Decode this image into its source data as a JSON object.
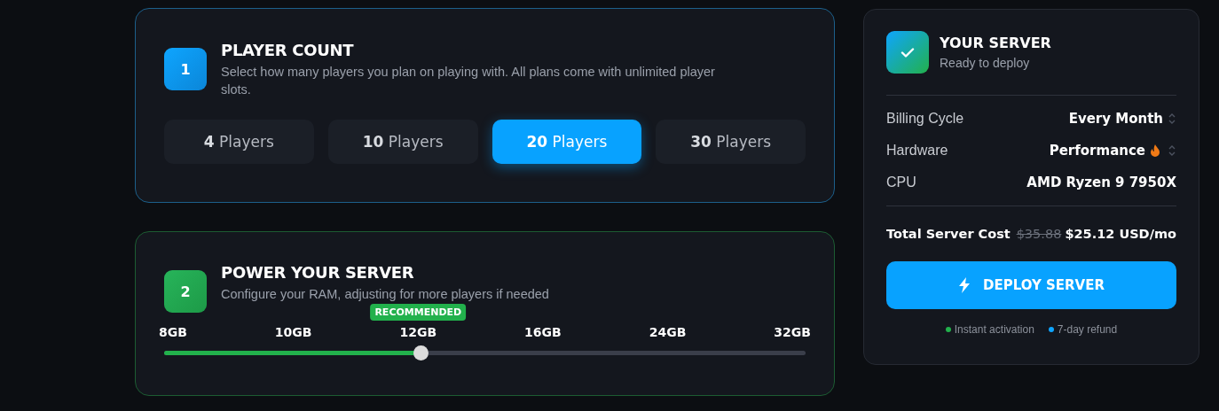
{
  "player_count": {
    "step": "1",
    "title": "PLAYER COUNT",
    "description": "Select how many players you plan on playing with. All plans come with unlimited player slots.",
    "options": [
      {
        "count": "4",
        "unit": "Players",
        "selected": false
      },
      {
        "count": "10",
        "unit": "Players",
        "selected": false
      },
      {
        "count": "20",
        "unit": "Players",
        "selected": true
      },
      {
        "count": "30",
        "unit": "Players",
        "selected": false
      }
    ]
  },
  "power": {
    "step": "2",
    "title": "POWER YOUR SERVER",
    "description": "Configure your RAM, adjusting for more players if needed",
    "level": 0.4,
    "ticks": [
      {
        "label": "8GB"
      },
      {
        "label": "10GB"
      },
      {
        "label": "12GB",
        "badge": "RECOMMENDED"
      },
      {
        "label": "16GB"
      },
      {
        "label": "24GB"
      },
      {
        "label": "32GB"
      }
    ]
  },
  "summary": {
    "title": "YOUR SERVER",
    "subtitle": "Ready to deploy",
    "rows": [
      {
        "label": "Billing Cycle",
        "value": "Every Month",
        "kind": "select",
        "flame": false
      },
      {
        "label": "Hardware",
        "value": "Performance",
        "kind": "select",
        "flame": true
      },
      {
        "label": "CPU",
        "value": "AMD Ryzen 9 7950X",
        "kind": "static",
        "flame": false
      }
    ],
    "total_label": "Total Server Cost",
    "old_price": "$35.88",
    "price": "$25.12 USD/mo",
    "button": "DEPLOY SERVER",
    "notes": [
      {
        "text": "Instant activation",
        "color": "#22b14c"
      },
      {
        "text": "7-day refund",
        "color": "#0ea5ff"
      }
    ]
  }
}
